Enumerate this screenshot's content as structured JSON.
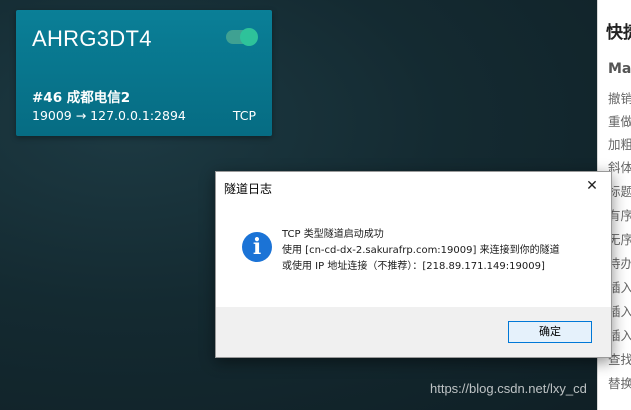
{
  "card": {
    "name": "AHRG3DT4",
    "enabled": true,
    "node": "#46 成都电信2",
    "mapping": "19009 → 127.0.0.1:2894",
    "protocol": "TCP",
    "colors": {
      "background": "#077a91",
      "toggle": "#2ec29a"
    }
  },
  "side_panel": {
    "title": "快捷",
    "subtitle": "Ma",
    "items": [
      "撤销",
      "重做",
      "加粗",
      "斜体",
      "标题",
      "有序",
      "无序",
      "待办",
      "插入",
      "插入",
      "插入",
      "查找",
      "替换"
    ]
  },
  "dialog": {
    "title": "隧道日志",
    "close_glyph": "✕",
    "icon": "info-icon",
    "icon_glyph": "i",
    "message_lines": [
      "TCP 类型隧道启动成功",
      "使用 [cn-cd-dx-2.sakurafrp.com:19009] 来连接到你的隧道",
      "或使用 IP 地址连接（不推荐）：[218.89.171.149:19009]"
    ],
    "ok_label": "确定"
  },
  "watermark": "https://blog.csdn.net/lxy_cd"
}
